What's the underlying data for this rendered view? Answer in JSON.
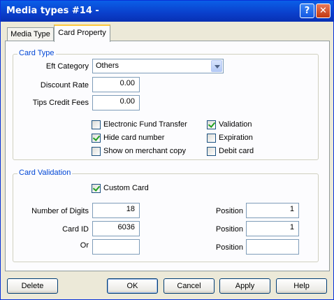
{
  "window": {
    "title": "Media types #14 -",
    "help_glyph": "?",
    "close_glyph": "✕"
  },
  "tabs": [
    {
      "label": "Media Type"
    },
    {
      "label": "Card Property"
    }
  ],
  "card_type": {
    "title": "Card Type",
    "eft_category": {
      "label": "Eft Category",
      "value": "Others"
    },
    "discount_rate": {
      "label": "Discount Rate",
      "value": "0.00"
    },
    "tips_credit_fees": {
      "label": "Tips Credit Fees",
      "value": "0.00"
    },
    "checkboxes": {
      "eft": {
        "label": "Electronic Fund Transfer",
        "checked": false
      },
      "hide_card": {
        "label": "Hide card number",
        "checked": true
      },
      "show_merchant": {
        "label": "Show on merchant copy",
        "checked": false
      },
      "validation": {
        "label": "Validation",
        "checked": true
      },
      "expiration": {
        "label": "Expiration",
        "checked": false
      },
      "debit": {
        "label": "Debit card",
        "checked": false
      }
    }
  },
  "card_validation": {
    "title": "Card Validation",
    "custom_card": {
      "label": "Custom Card",
      "checked": true
    },
    "number_of_digits": {
      "label": "Number of Digits",
      "value": "18"
    },
    "card_id": {
      "label": "Card ID",
      "value": "6036"
    },
    "or": {
      "label": "Or",
      "value": ""
    },
    "positions": [
      {
        "label": "Position",
        "value": "1"
      },
      {
        "label": "Position",
        "value": "1"
      },
      {
        "label": "Position",
        "value": ""
      }
    ]
  },
  "buttons": {
    "delete": "Delete",
    "ok": "OK",
    "cancel": "Cancel",
    "apply": "Apply",
    "help": "Help"
  },
  "colors": {
    "titlebar": "#0A3FCB",
    "dialog_bg": "#ECE9D8",
    "group_title": "#0046D5",
    "check": "#21A121"
  }
}
